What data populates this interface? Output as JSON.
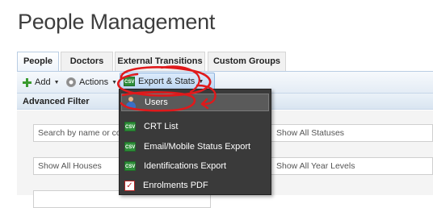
{
  "page": {
    "title": "People Management"
  },
  "tabs": [
    {
      "label": "People",
      "active": true
    },
    {
      "label": "Doctors",
      "active": false
    },
    {
      "label": "External Transitions",
      "active": false
    },
    {
      "label": "Custom Groups",
      "active": false
    }
  ],
  "toolbar": {
    "add_label": "Add",
    "actions_label": "Actions",
    "export_label": "Export & Stats",
    "csv_badge": "CSV"
  },
  "panel": {
    "title": "Advanced Filter"
  },
  "filters": {
    "search_placeholder": "Search by name or code",
    "statuses_value": "Show All Statuses",
    "houses_value": "Show All Houses",
    "year_levels_value": "Show All Year Levels"
  },
  "export_menu": {
    "items": [
      {
        "label": "Users",
        "icon": "user-icon"
      },
      {
        "label": "CRT List",
        "icon": "csv-icon"
      },
      {
        "label": "Email/Mobile Status Export",
        "icon": "csv-icon"
      },
      {
        "label": "Identifications Export",
        "icon": "csv-icon"
      },
      {
        "label": "Enrolments PDF",
        "icon": "pdf-icon"
      }
    ]
  },
  "colors": {
    "annotation": "#e0191b",
    "menu_bg": "#3a3a3a",
    "export_button": "#bcd6f3"
  }
}
